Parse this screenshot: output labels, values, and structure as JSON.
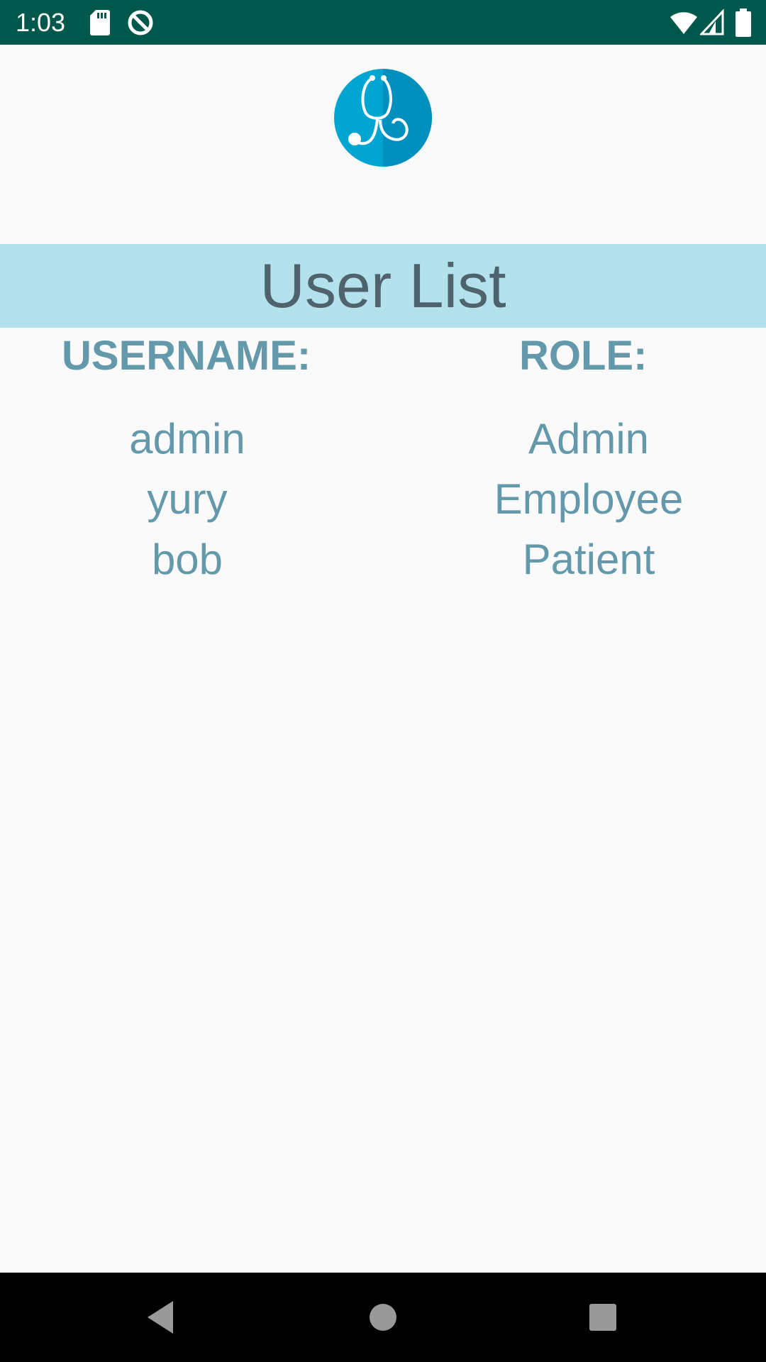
{
  "status_bar": {
    "time": "1:03",
    "icons_left": [
      "sd-card-icon",
      "data-saver-icon"
    ],
    "icons_right": [
      "wifi-icon",
      "cell-signal-icon",
      "battery-icon"
    ],
    "background_color": "#00574b"
  },
  "app": {
    "logo_icon": "stethoscope-icon",
    "title": "User List",
    "title_band_color": "#b3e1ec",
    "accent_color": "#6399ab"
  },
  "table": {
    "headers": {
      "username": "USERNAME:",
      "role": "ROLE:"
    },
    "rows": [
      {
        "username": "admin",
        "role": "Admin"
      },
      {
        "username": "yury",
        "role": "Employee"
      },
      {
        "username": "bob",
        "role": "Patient"
      }
    ]
  },
  "nav_bar": {
    "buttons": [
      "back-icon",
      "home-icon",
      "recents-icon"
    ]
  }
}
